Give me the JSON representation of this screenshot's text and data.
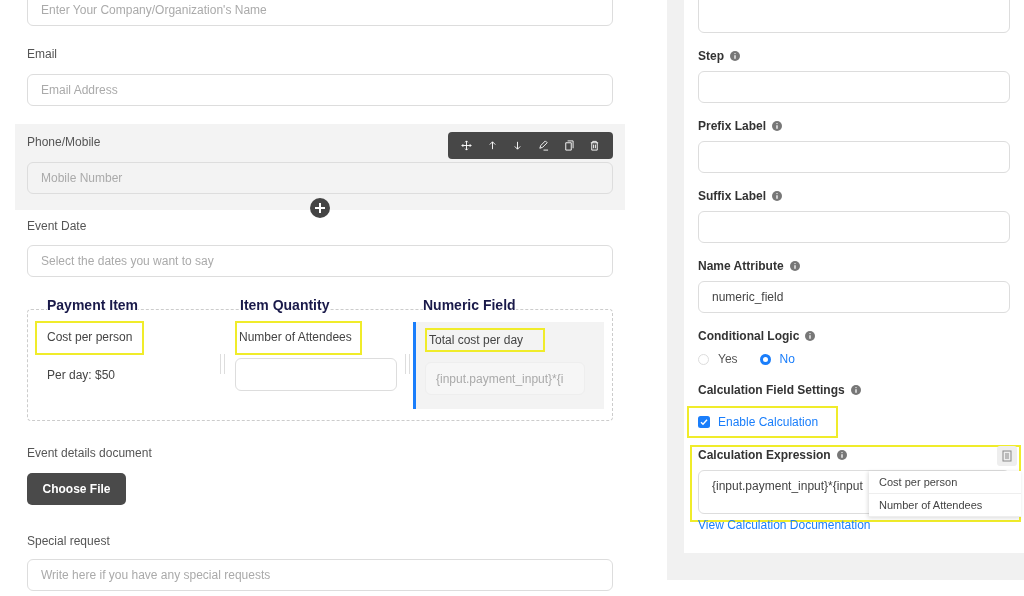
{
  "form": {
    "company_field": {
      "placeholder": "Enter Your Company/Organization's Name"
    },
    "email": {
      "label": "Email",
      "placeholder": "Email Address"
    },
    "phone": {
      "label": "Phone/Mobile",
      "placeholder": "Mobile Number",
      "selected": true
    },
    "event_date": {
      "label": "Event Date",
      "placeholder": "Select the dates you want to say"
    },
    "columns": [
      {
        "heading": "Payment Item",
        "kind": "text",
        "label": "Cost per person",
        "highlighted": true,
        "text": "Per day: $50",
        "selected": false
      },
      {
        "heading": "Item Quantity",
        "kind": "input",
        "label": "Number of Attendees",
        "highlighted": true,
        "selected": false
      },
      {
        "heading": "Numeric Field",
        "kind": "input",
        "label": "Total cost per day",
        "highlighted": true,
        "placeholder": "{input.payment_input}*{i",
        "selected": true
      }
    ],
    "document": {
      "label": "Event details document",
      "button": "Choose File"
    },
    "special_request": {
      "label": "Special request",
      "placeholder": "Write here if you have any special requests"
    }
  },
  "settings": {
    "fields": [
      {
        "label": "Step"
      },
      {
        "label": "Prefix Label"
      },
      {
        "label": "Suffix Label"
      },
      {
        "label": "Name Attribute",
        "value": "numeric_field"
      }
    ],
    "conditional_logic": {
      "label": "Conditional Logic",
      "options": [
        {
          "label": "Yes",
          "selected": false
        },
        {
          "label": "No",
          "selected": true
        }
      ]
    },
    "calculation": {
      "label": "Calculation Field Settings",
      "checkbox": {
        "label": "Enable Calculation",
        "checked": true,
        "highlighted": true
      }
    },
    "expression": {
      "label": "Calculation Expression",
      "value": "{input.payment_input}*{input",
      "highlighted": true,
      "menu": [
        "Cost per person",
        "Number of Attendees"
      ],
      "link": "View Calculation Documentation"
    }
  }
}
